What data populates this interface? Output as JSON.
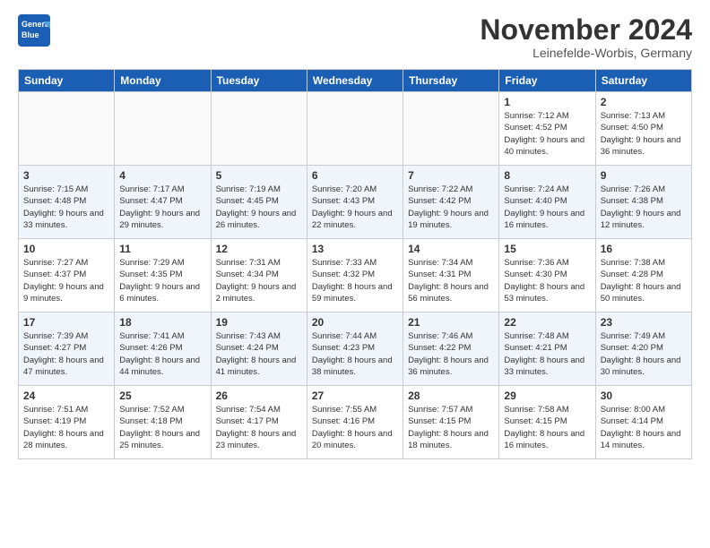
{
  "logo": {
    "general": "General",
    "blue": "Blue"
  },
  "title": "November 2024",
  "location": "Leinefelde-Worbis, Germany",
  "days_of_week": [
    "Sunday",
    "Monday",
    "Tuesday",
    "Wednesday",
    "Thursday",
    "Friday",
    "Saturday"
  ],
  "weeks": [
    [
      {
        "day": "",
        "info": ""
      },
      {
        "day": "",
        "info": ""
      },
      {
        "day": "",
        "info": ""
      },
      {
        "day": "",
        "info": ""
      },
      {
        "day": "",
        "info": ""
      },
      {
        "day": "1",
        "info": "Sunrise: 7:12 AM\nSunset: 4:52 PM\nDaylight: 9 hours and 40 minutes."
      },
      {
        "day": "2",
        "info": "Sunrise: 7:13 AM\nSunset: 4:50 PM\nDaylight: 9 hours and 36 minutes."
      }
    ],
    [
      {
        "day": "3",
        "info": "Sunrise: 7:15 AM\nSunset: 4:48 PM\nDaylight: 9 hours and 33 minutes."
      },
      {
        "day": "4",
        "info": "Sunrise: 7:17 AM\nSunset: 4:47 PM\nDaylight: 9 hours and 29 minutes."
      },
      {
        "day": "5",
        "info": "Sunrise: 7:19 AM\nSunset: 4:45 PM\nDaylight: 9 hours and 26 minutes."
      },
      {
        "day": "6",
        "info": "Sunrise: 7:20 AM\nSunset: 4:43 PM\nDaylight: 9 hours and 22 minutes."
      },
      {
        "day": "7",
        "info": "Sunrise: 7:22 AM\nSunset: 4:42 PM\nDaylight: 9 hours and 19 minutes."
      },
      {
        "day": "8",
        "info": "Sunrise: 7:24 AM\nSunset: 4:40 PM\nDaylight: 9 hours and 16 minutes."
      },
      {
        "day": "9",
        "info": "Sunrise: 7:26 AM\nSunset: 4:38 PM\nDaylight: 9 hours and 12 minutes."
      }
    ],
    [
      {
        "day": "10",
        "info": "Sunrise: 7:27 AM\nSunset: 4:37 PM\nDaylight: 9 hours and 9 minutes."
      },
      {
        "day": "11",
        "info": "Sunrise: 7:29 AM\nSunset: 4:35 PM\nDaylight: 9 hours and 6 minutes."
      },
      {
        "day": "12",
        "info": "Sunrise: 7:31 AM\nSunset: 4:34 PM\nDaylight: 9 hours and 2 minutes."
      },
      {
        "day": "13",
        "info": "Sunrise: 7:33 AM\nSunset: 4:32 PM\nDaylight: 8 hours and 59 minutes."
      },
      {
        "day": "14",
        "info": "Sunrise: 7:34 AM\nSunset: 4:31 PM\nDaylight: 8 hours and 56 minutes."
      },
      {
        "day": "15",
        "info": "Sunrise: 7:36 AM\nSunset: 4:30 PM\nDaylight: 8 hours and 53 minutes."
      },
      {
        "day": "16",
        "info": "Sunrise: 7:38 AM\nSunset: 4:28 PM\nDaylight: 8 hours and 50 minutes."
      }
    ],
    [
      {
        "day": "17",
        "info": "Sunrise: 7:39 AM\nSunset: 4:27 PM\nDaylight: 8 hours and 47 minutes."
      },
      {
        "day": "18",
        "info": "Sunrise: 7:41 AM\nSunset: 4:26 PM\nDaylight: 8 hours and 44 minutes."
      },
      {
        "day": "19",
        "info": "Sunrise: 7:43 AM\nSunset: 4:24 PM\nDaylight: 8 hours and 41 minutes."
      },
      {
        "day": "20",
        "info": "Sunrise: 7:44 AM\nSunset: 4:23 PM\nDaylight: 8 hours and 38 minutes."
      },
      {
        "day": "21",
        "info": "Sunrise: 7:46 AM\nSunset: 4:22 PM\nDaylight: 8 hours and 36 minutes."
      },
      {
        "day": "22",
        "info": "Sunrise: 7:48 AM\nSunset: 4:21 PM\nDaylight: 8 hours and 33 minutes."
      },
      {
        "day": "23",
        "info": "Sunrise: 7:49 AM\nSunset: 4:20 PM\nDaylight: 8 hours and 30 minutes."
      }
    ],
    [
      {
        "day": "24",
        "info": "Sunrise: 7:51 AM\nSunset: 4:19 PM\nDaylight: 8 hours and 28 minutes."
      },
      {
        "day": "25",
        "info": "Sunrise: 7:52 AM\nSunset: 4:18 PM\nDaylight: 8 hours and 25 minutes."
      },
      {
        "day": "26",
        "info": "Sunrise: 7:54 AM\nSunset: 4:17 PM\nDaylight: 8 hours and 23 minutes."
      },
      {
        "day": "27",
        "info": "Sunrise: 7:55 AM\nSunset: 4:16 PM\nDaylight: 8 hours and 20 minutes."
      },
      {
        "day": "28",
        "info": "Sunrise: 7:57 AM\nSunset: 4:15 PM\nDaylight: 8 hours and 18 minutes."
      },
      {
        "day": "29",
        "info": "Sunrise: 7:58 AM\nSunset: 4:15 PM\nDaylight: 8 hours and 16 minutes."
      },
      {
        "day": "30",
        "info": "Sunrise: 8:00 AM\nSunset: 4:14 PM\nDaylight: 8 hours and 14 minutes."
      }
    ]
  ]
}
